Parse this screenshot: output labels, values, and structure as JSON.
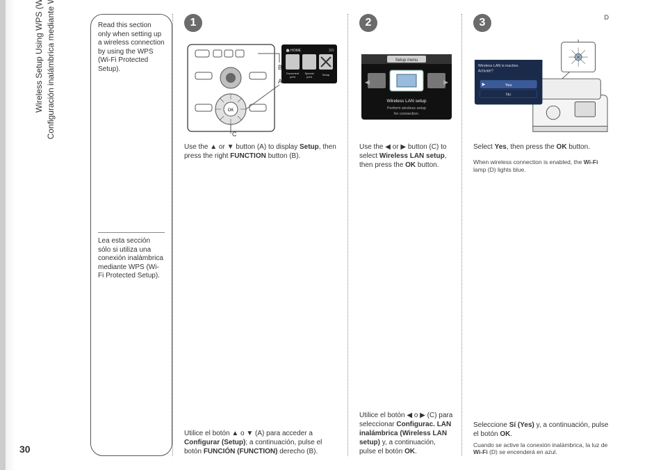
{
  "page_number": "30",
  "side_title_en": "Wireless Setup Using WPS (Wi-Fi Protected Setup)",
  "side_title_es": "Configuración inalámbrica mediante WPS (Wi-Fi Protected Setup)",
  "intro": {
    "en": "Read this section only when setting up a wireless connection by using the WPS (Wi-Fi Protected Setup).",
    "es": "Lea esta sección sólo si utiliza una conexión inalámbrica mediante WPS (Wi-Fi Protected Setup)."
  },
  "steps": [
    {
      "num": "1",
      "en_parts": [
        "Use the ▲ or ▼ button (A) to display ",
        "Setup",
        ", then press the right ",
        "FUNCTION",
        " button (B)."
      ],
      "es_parts": [
        "Utilice el botón ▲ o ▼ (A) para acceder a ",
        "Configurar (Setup)",
        "; a continuación, pulse el botón ",
        "FUNCIÓN (FUNCTION)",
        " derecho (B)."
      ],
      "labels": {
        "A": "A",
        "B": "B",
        "C": "C"
      },
      "screen": {
        "title": "HOME",
        "page": "3/3",
        "items": [
          "Document print",
          "Special print",
          "Setup"
        ]
      }
    },
    {
      "num": "2",
      "en_parts": [
        "Use the ◀ or ▶ button (C) to select ",
        "Wireless LAN setup",
        ", then press the ",
        "OK",
        " button."
      ],
      "es_parts": [
        "Utilice el botón ◀ o ▶ (C) para seleccionar ",
        "Configurac. LAN inalámbrica (Wireless LAN setup)",
        " y, a continuación, pulse el botón ",
        "OK",
        "."
      ],
      "screen": {
        "title": "Setup menu",
        "cap1": "Wireless LAN setup",
        "cap2": "Perform wireless setup for connection."
      }
    },
    {
      "num": "3",
      "en_parts": [
        "Select ",
        "Yes",
        ", then press the ",
        "OK",
        " button."
      ],
      "en_note_parts": [
        "When wireless connection is enabled, the ",
        "Wi-Fi",
        " lamp (D) lights blue."
      ],
      "es_parts": [
        "Seleccione ",
        "Sí (Yes)",
        " y, a continuación, pulse el botón ",
        "OK",
        "."
      ],
      "es_note_parts": [
        "Cuando se active la conexión inalámbrica, la luz de ",
        "Wi-Fi",
        " (D) se encenderá en azul."
      ],
      "label_d": "D",
      "screen": {
        "line1": "Wireless LAN is inactive.",
        "line2": "Activate?",
        "yes": "Yes",
        "no": "No"
      }
    }
  ]
}
